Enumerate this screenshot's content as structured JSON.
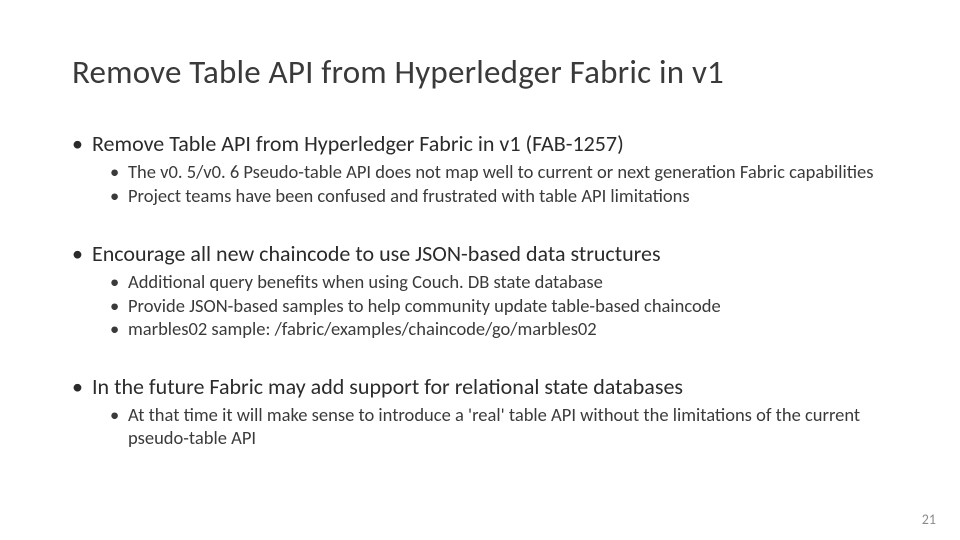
{
  "title": "Remove Table API from Hyperledger Fabric in v1",
  "bullets": [
    {
      "text": "Remove Table API from Hyperledger Fabric in v1 (FAB-1257)",
      "sub": [
        "The v0. 5/v0. 6 Pseudo-table API does not map well to current or next generation Fabric capabilities",
        "Project teams have been confused and frustrated with table API limitations"
      ]
    },
    {
      "text": "Encourage all new chaincode to use JSON-based data structures",
      "sub": [
        "Additional query benefits when using Couch. DB state database",
        "Provide JSON-based samples to help community update table-based chaincode",
        "marbles02 sample: /fabric/examples/chaincode/go/marbles02"
      ]
    },
    {
      "text": "In the future Fabric may add support for relational state databases",
      "sub": [
        "At that time it will make sense to introduce a 'real' table API without the limitations of the current pseudo-table API"
      ]
    }
  ],
  "page_number": "21"
}
